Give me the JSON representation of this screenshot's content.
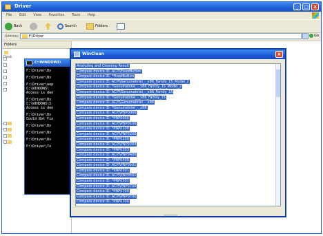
{
  "explorer": {
    "title": "Driver",
    "menu": [
      "File",
      "Edit",
      "View",
      "Favorites",
      "Tools",
      "Help"
    ],
    "toolbar": {
      "back_label": "Back",
      "search_label": "Search",
      "folders_label": "Folders"
    },
    "address_label": "Address",
    "address_value": "F:\\Driver",
    "go_label": "Go",
    "folders_pane_title": "Folders",
    "tree_root_label": "Desk"
  },
  "cmd": {
    "title": "C:\\WINDOWS\\",
    "lines": [
      "F:\\Driver\\Bx",
      "",
      "F:\\Driver\\Bx",
      "",
      "F:\\Driver\\eep",
      "C:\\WINDOWS\\",
      "Access is den",
      "",
      "F:\\Driver\\Bx",
      "C:\\WINDOWS\\S",
      "Access is den",
      "",
      "F:\\Driver\\Bx",
      "Could Not Fin",
      "",
      "F:\\Driver\\Bx",
      "",
      "F:\\Driver\\Bx",
      "",
      "F:\\Driver\\Bx",
      "",
      "F:\\Driver\\Tn"
    ]
  },
  "winclean": {
    "title": "WinClean",
    "lines": [
      "Analyzing and Cleaning Result",
      "Compare device ID: ACPI\\FixedButton",
      "Compare device ID: *FixedButton",
      "Compare device ID: ACPI\\GenuineIntel_-_x86_Family_15_Model_2",
      "Compare device ID: *GenuineIntel_-_x86_Family_15_Model_2",
      "Compare device ID: ACPI\\GenuineIntel_-_x86_Family_15",
      "Compare device ID: *GenuineIntel_-_x86_Family_15",
      "Compare device ID: ACPI\\GenuineIntel_-_x86",
      "Compare device ID: *GenuineIntel_-_x86",
      "Compare device ID: ACPI\\PNP0000",
      "Compare device ID: *PNP0000",
      "Compare device ID: ACPI\\PNP0100",
      "Compare device ID: *PNP0100",
      "Compare device ID: ACPI\\PNP0200",
      "Compare device ID: *PNP0200",
      "Compare device ID: ACPI\\PNP0303",
      "Compare device ID: *PNP0303",
      "Compare device ID: ACPI\\PNP0400",
      "Compare device ID: *PNP0400",
      "Compare device ID: ACPI\\PNP0501",
      "Compare device ID: *PNP0501",
      "Compare device ID: ACPI\\PNP0501",
      "Compare device ID: *PNP0501",
      "Compare device ID: ACPI\\PNP0700",
      "Compare device ID: *PNP0700",
      "Compare device ID: ACPI\\PNP0700",
      "Compare device ID: *PNP0700"
    ]
  }
}
